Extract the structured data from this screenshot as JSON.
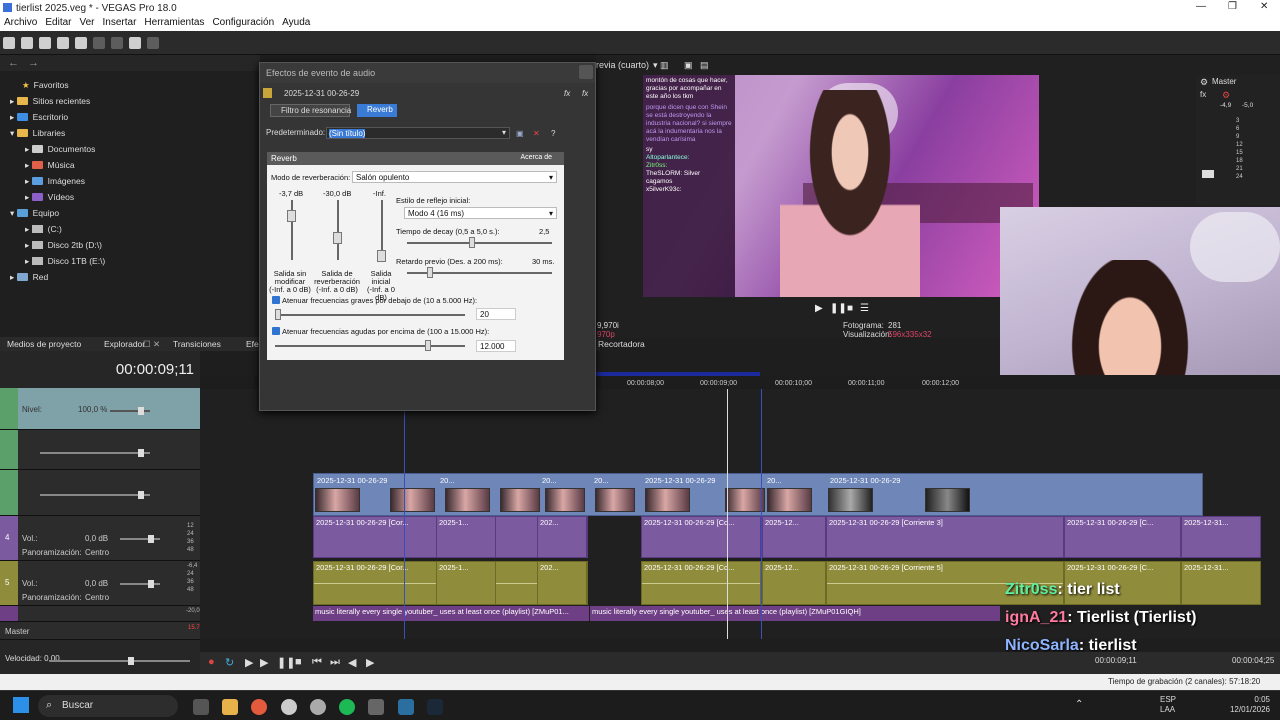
{
  "window": {
    "title": "tierlist 2025.veg * - VEGAS Pro 18.0"
  },
  "menu": [
    "Archivo",
    "Editar",
    "Ver",
    "Insertar",
    "Herramientas",
    "Configuración",
    "Ayuda"
  ],
  "explorer": {
    "items": [
      {
        "label": "Favoritos",
        "type": "star"
      },
      {
        "label": "Sitios recientes",
        "type": "folder"
      },
      {
        "label": "Escritorio",
        "type": "folder"
      },
      {
        "label": "Libraries",
        "type": "folder"
      },
      {
        "label": "Documentos",
        "type": "folder"
      },
      {
        "label": "Música",
        "type": "folder"
      },
      {
        "label": "Imágenes",
        "type": "folder"
      },
      {
        "label": "Vídeos",
        "type": "folder"
      },
      {
        "label": "Equipo",
        "type": "folder"
      },
      {
        "label": "(C:)",
        "type": "drive"
      },
      {
        "label": "Disco 2tb (D:\\)",
        "type": "drive"
      },
      {
        "label": "Disco 1TB (E:\\)",
        "type": "drive"
      },
      {
        "label": "Red",
        "type": "network"
      }
    ]
  },
  "tabs": [
    "Medios de proyecto",
    "Explorador",
    "Transiciones",
    "Efe",
    "Recortadora"
  ],
  "timeline": {
    "timecode": "00:00:09;11",
    "ruler": [
      "00:00:08;00",
      "00:00:09;00",
      "00:00:10;00",
      "00:00:11;00",
      "00:00:12;00"
    ],
    "level_label": "Nivel:",
    "level_value": "100,0 %",
    "track4": {
      "vol_label": "Vol.:",
      "vol_value": "0,0 dB",
      "pan_label": "Panoramización:",
      "pan_value": "Centro",
      "num": "4"
    },
    "track5": {
      "vol_label": "Vol.:",
      "vol_value": "0,0 dB",
      "pan_label": "Panoramización:",
      "pan_value": "Centro",
      "num": "5"
    },
    "meter_labels_a": [
      "12",
      "24",
      "36",
      "48"
    ],
    "meter_labels_b": [
      "-6,4",
      "24",
      "36",
      "48"
    ],
    "meter_c": "-20,0",
    "master_label": "Master",
    "speed_label": "Velocidad: 0,00",
    "clip_name": "2025-12-31 00-26-29",
    "video_clips": [
      "2025-12-31 00-26-29",
      "20...",
      "20...",
      "20...",
      "2025-12-31 00-26-29",
      "20...",
      "2025-12-31 00-26-29"
    ],
    "audio_clips_a": [
      "2025-12-31 00-26-29 [Cor...",
      "2025-1...",
      "202...",
      "2025-12-31 00-26-29 [Co...",
      "2025-12...",
      "2025-12-31 00-26-29 [Corriente 3]",
      "2025-12-31 00-26-29 [C...",
      "2025-12-31..."
    ],
    "audio_clips_b": [
      "2025-12-31 00-26-29 [Cor...",
      "2025-1...",
      "202...",
      "2025-12-31 00-26-29 [Co...",
      "2025-12...",
      "2025-12-31 00-26-29 [Corriente 5]",
      "2025-12-31 00-26-29 [C...",
      "2025-12-31..."
    ],
    "music_a": "music literally every single youtuber_ uses at least once (playlist) [ZMuP01...",
    "music_b": "music literally every single youtuber_ uses at least once (playlist) [ZMuP01GIQH]",
    "end_time": "00:00:09;11",
    "end_time2": "00:00:04;25"
  },
  "preview": {
    "quality": "revia (cuarto)",
    "frame_label": "Fotograma:",
    "frame_value": "281",
    "display_label": "Visualización:",
    "display_value": "596x335x32",
    "left_info_a": "9,970i",
    "left_info_b": "970p",
    "master": "Master",
    "master_vals": [
      "-4,9",
      "-5,0"
    ],
    "master_scale": [
      "3",
      "6",
      "9",
      "12",
      "15",
      "18",
      "21",
      "24"
    ]
  },
  "stream_chat": {
    "lines": [
      "montón de cosas que hacer, gracias por acompañar en este año los tkm",
      "porque dicen que con Shein se está destroyendo la industria nacional? si siempre acá la indumentaria nos la vendían carísima",
      "sy",
      "Altoparlantece:",
      "Zitr0ss:",
      "TheSLORM: Silver",
      "cagamos",
      "x5ilverK93c:"
    ]
  },
  "overlay_chat": [
    {
      "user": "Zitr0ss",
      "msg": ": tier list",
      "color": "#5ef0a0"
    },
    {
      "user": "ignA_21",
      "msg": ": Tierlist (Tierlist)",
      "color": "#ff7aa0"
    },
    {
      "user": "NicoSarla",
      "msg": ": tierlist",
      "color": "#8fb4ff"
    }
  ],
  "dialog": {
    "title": "Efectos de evento de audio",
    "event": "2025-12-31 00-26-29",
    "chain": [
      "Filtro de resonancia",
      "Reverb"
    ],
    "preset_label": "Predeterminado:",
    "preset_value": "(Sin título)",
    "panel_title": "Reverb",
    "about": "Acerca de",
    "mode_label": "Modo de reverberación:",
    "mode_value": "Salón opulento",
    "fader_vals": [
      "-3,7 dB",
      "-30,0 dB",
      "-Inf."
    ],
    "fader_labels": [
      "Salida sin modificar (-Inf. a 0 dB)",
      "Salida de reverberación (-Inf. a 0 dB)",
      "Salida inicial (-Inf. a 0 dB)"
    ],
    "fader_lines": [
      [
        "Salida sin",
        "modificar",
        "(-Inf. a 0 dB)"
      ],
      [
        "Salida de",
        "reverberación",
        "(-Inf. a 0 dB)"
      ],
      [
        "Salida",
        "inicial",
        "(-Inf. a 0 dB)"
      ]
    ],
    "reflect_label": "Estilo de reflejo inicial:",
    "reflect_value": "Modo 4 (16 ms)",
    "decay_label": "Tiempo de decay (0,5 a 5,0 s.):",
    "decay_value": "2,5",
    "predelay_label": "Retardo previo (Des. a 200 ms):",
    "predelay_value": "30 ms.",
    "low_label": "Atenuar frecuencias graves por debajo de (10 a 5.000 Hz):",
    "low_value": "20",
    "high_label": "Atenuar frecuencias agudas por encima de (100 a 15.000 Hz):",
    "high_value": "12.000"
  },
  "status": {
    "text": "Tiempo de grabación (2 canales): 57:18:20"
  },
  "taskbar": {
    "search": "Buscar",
    "lang": "ESP",
    "lang2": "LAA",
    "time": "0:05",
    "date": "12/01/2026"
  }
}
